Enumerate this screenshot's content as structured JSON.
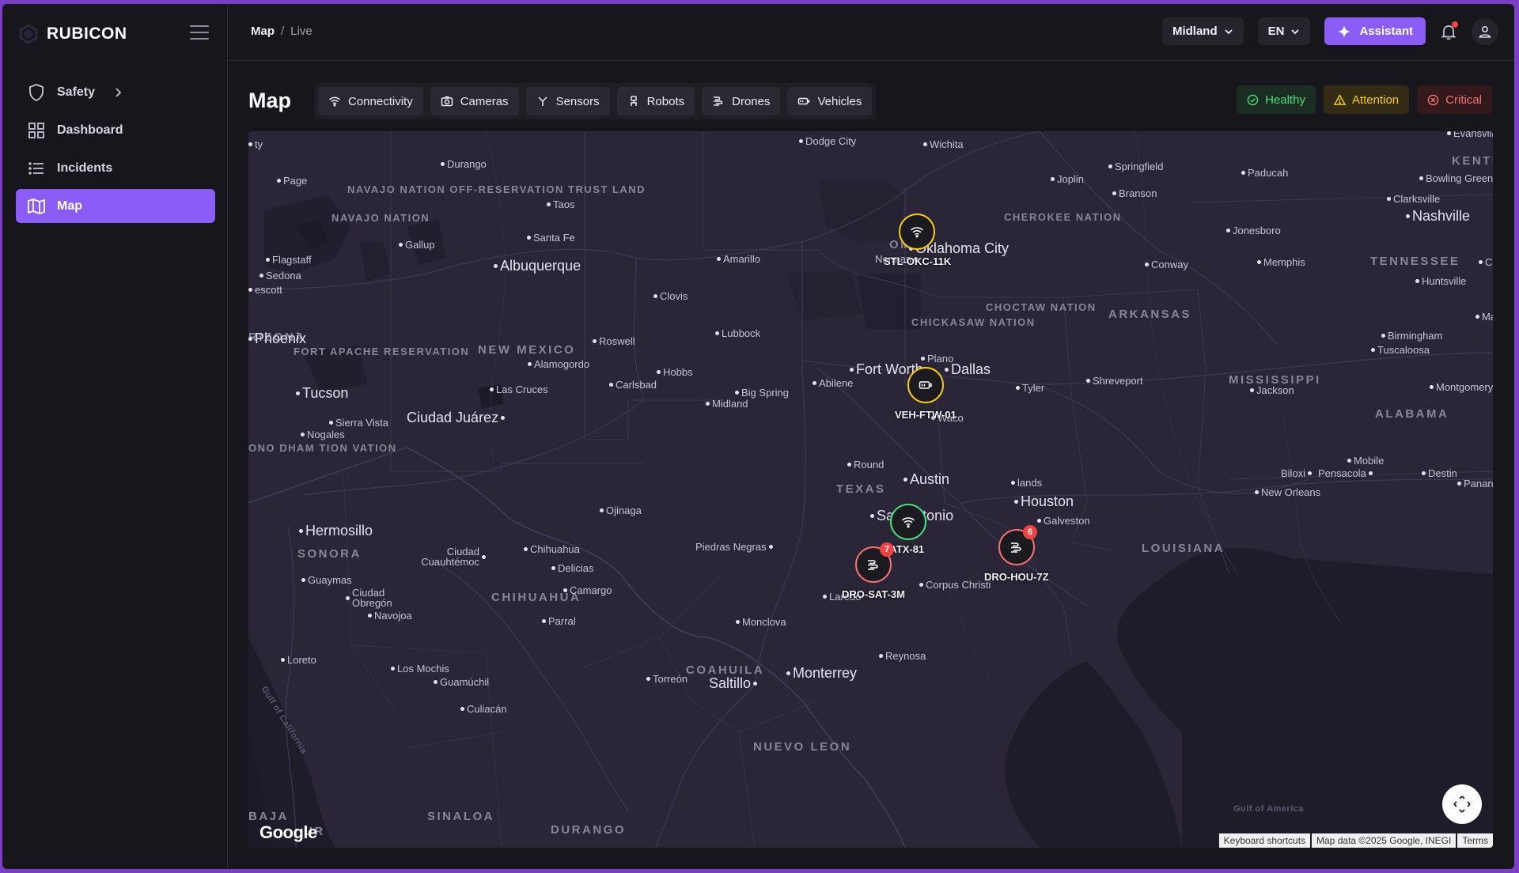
{
  "app": {
    "name": "RUBICON"
  },
  "sidebar": {
    "items": [
      {
        "label": "Safety"
      },
      {
        "label": "Dashboard"
      },
      {
        "label": "Incidents"
      },
      {
        "label": "Map"
      }
    ]
  },
  "breadcrumb": {
    "main": "Map",
    "separator": "/",
    "sub": "Live"
  },
  "topbar": {
    "site": "Midland",
    "language": "EN",
    "assistant_label": "Assistant"
  },
  "page": {
    "title": "Map"
  },
  "filters": [
    {
      "label": "Connectivity",
      "icon": "wifi-icon"
    },
    {
      "label": "Cameras",
      "icon": "camera-icon"
    },
    {
      "label": "Sensors",
      "icon": "sensor-icon"
    },
    {
      "label": "Robots",
      "icon": "robot-icon"
    },
    {
      "label": "Drones",
      "icon": "drone-icon"
    },
    {
      "label": "Vehicles",
      "icon": "vehicle-icon"
    }
  ],
  "statuses": [
    {
      "label": "Healthy",
      "color": "#4ade80"
    },
    {
      "label": "Attention",
      "color": "#facc15"
    },
    {
      "label": "Critical",
      "color": "#f87171"
    }
  ],
  "map": {
    "regions": [
      "NAVAJO NATION",
      "NAVAJO NATION OFF-RESERVATION TRUST LAND",
      "NEW MEXICO",
      "FORT APACHE RESERVATION",
      "TEXAS",
      "SONORA",
      "CHIHUAHUA",
      "COAHUILA",
      "NUEVO LEON",
      "SINALOA",
      "DURANGO",
      "BAJA",
      "ARKANSAS",
      "MISSISSIPPI",
      "ALABAMA",
      "LOUISIANA",
      "TENNESSEE",
      "KENTU",
      "CHEROKEE NATION",
      "CHICKASAW NATION",
      "CHOCTAW NATION",
      "RIZONA",
      "ONO DHAM TION VATION",
      "UR",
      "OMA"
    ],
    "cities": {
      "dodge_city": "Dodge City",
      "wichita": "Wichita",
      "joplin": "Joplin",
      "springfield": "Springfield",
      "paducah": "Paducah",
      "bowling_green": "Bowling Green",
      "durango": "Durango",
      "page": "Page",
      "taos": "Taos",
      "branson": "Branson",
      "clarksville": "Clarksville",
      "nashville": "Nashville",
      "santa_fe": "Santa Fe",
      "gallup": "Gallup",
      "jonesboro": "Jonesboro",
      "flagstaff": "Flagstaff",
      "albuquerque": "Albuquerque",
      "amarillo": "Amarillo",
      "oklahoma_city": "Oklahoma City",
      "norman": "Norman",
      "conway": "Conway",
      "memphis": "Memphis",
      "sedona": "Sedona",
      "prescott": "escott",
      "clovis": "Clovis",
      "huntsville": "Huntsville",
      "lubbock": "Lubbock",
      "phoenix": "Phoenix",
      "roswell": "Roswell",
      "birmingham": "Birmingham",
      "tuscaloosa": "Tuscaloosa",
      "alamogordo": "Alamogordo",
      "hobbs": "Hobbs",
      "fort_worth": "Fort Worth",
      "dallas": "Dallas",
      "abilene": "Abilene",
      "carlsbad": "Carlsbad",
      "tyler": "Tyler",
      "shreveport": "Shreveport",
      "las_cruces": "Las Cruces",
      "big_spring": "Big Spring",
      "midland": "Midland",
      "jackson": "Jackson",
      "montgomery": "Montgomery",
      "tucson": "Tucson",
      "ciudad_juarez": "Ciudad Juárez",
      "waco": "Waco",
      "sierra_vista": "Sierra Vista",
      "nogales": "Nogales",
      "mobile": "Mobile",
      "biloxi": "Biloxi",
      "pensacola": "Pensacola",
      "destin": "Destin",
      "panama": "Panan",
      "round_rock": "Round",
      "austin": "Austin",
      "woodlands": "lands",
      "new_orleans": "New Orleans",
      "houston": "Houston",
      "ojinaga": "Ojinaga",
      "san_antonio": "San Antonio",
      "galveston": "Galveston",
      "hermosillo": "Hermosillo",
      "chihuahua": "Chihuahua",
      "piedras_negras": "Piedras Negras",
      "cuauhtemoc": "Ciudad Cuauhtémoc",
      "delicias": "Delicias",
      "guaymas": "Guaymas",
      "corpus_christi": "Corpus Christi",
      "camargo": "Camargo",
      "obregon": "Ciudad Obregón",
      "laredo": "Laredo",
      "navojoa": "Navojoa",
      "parral": "Parral",
      "monclova": "Monclova",
      "reynosa": "Reynosa",
      "loreto": "Loreto",
      "los_mochis": "Los Mochis",
      "monterrey": "Monterrey",
      "torreon": "Torreón",
      "saltillo": "Saltillo",
      "guamuchil": "Guamúchil",
      "culiacan": "Culiacán",
      "evansville": "Evansville",
      "city_partial": "ty",
      "plano": "Plano",
      "marietta": "Marie",
      "chattanooga": "Ch"
    },
    "water": {
      "gulf_california": "Gulf of California",
      "gulf_america": "Gulf of America"
    },
    "markers": [
      {
        "id": "STL-OKC-11K",
        "status": "attention",
        "icon": "wifi-icon"
      },
      {
        "id": "VEH-FTW-01",
        "status": "attention",
        "icon": "vehicle-icon"
      },
      {
        "id": "-ATX-81",
        "status": "healthy",
        "icon": "wifi-icon"
      },
      {
        "id": "DRO-SAT-3M",
        "status": "critical",
        "icon": "drone-icon",
        "count": "7"
      },
      {
        "id": "DRO-HOU-7Z",
        "status": "critical",
        "icon": "drone-icon",
        "count": "6"
      }
    ],
    "logo": "Google",
    "attribution": [
      "Keyboard shortcuts",
      "Map data ©2025 Google, INEGI",
      "Terms"
    ]
  }
}
